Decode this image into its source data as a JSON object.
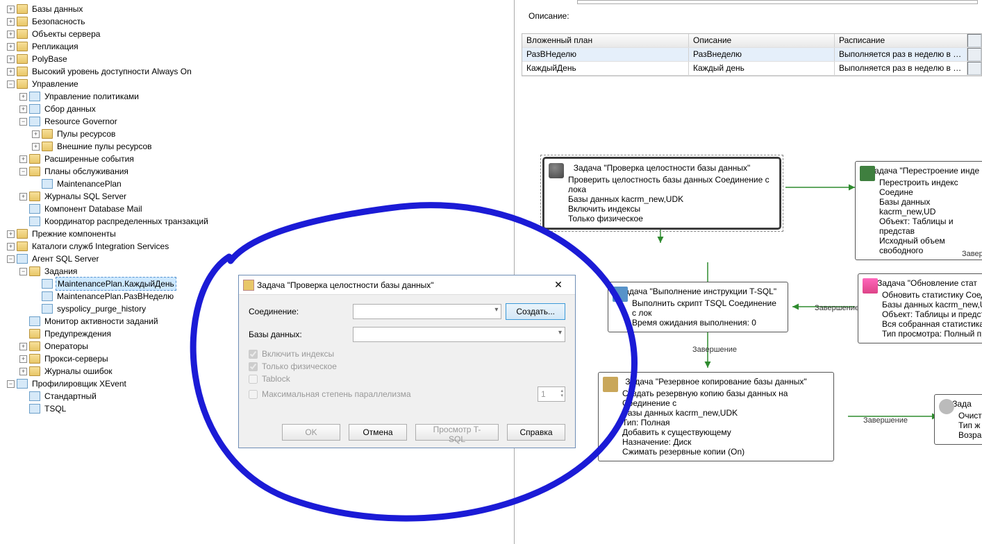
{
  "tree": {
    "items": [
      {
        "ind": 0,
        "exp": "+",
        "icon": "folder",
        "label": "Базы данных"
      },
      {
        "ind": 0,
        "exp": "+",
        "icon": "folder",
        "label": "Безопасность"
      },
      {
        "ind": 0,
        "exp": "+",
        "icon": "folder",
        "label": "Объекты сервера"
      },
      {
        "ind": 0,
        "exp": "+",
        "icon": "folder",
        "label": "Репликация"
      },
      {
        "ind": 0,
        "exp": "+",
        "icon": "folder",
        "label": "PolyBase"
      },
      {
        "ind": 0,
        "exp": "+",
        "icon": "folder",
        "label": "Высокий уровень доступности Always On"
      },
      {
        "ind": 0,
        "exp": "−",
        "icon": "folder",
        "label": "Управление"
      },
      {
        "ind": 1,
        "exp": "+",
        "icon": "generic",
        "label": "Управление политиками"
      },
      {
        "ind": 1,
        "exp": "+",
        "icon": "generic",
        "label": "Сбор данных"
      },
      {
        "ind": 1,
        "exp": "−",
        "icon": "generic",
        "label": "Resource Governor"
      },
      {
        "ind": 2,
        "exp": "+",
        "icon": "folder",
        "label": "Пулы ресурсов"
      },
      {
        "ind": 2,
        "exp": "+",
        "icon": "folder",
        "label": "Внешние пулы ресурсов"
      },
      {
        "ind": 1,
        "exp": "+",
        "icon": "folder",
        "label": "Расширенные события"
      },
      {
        "ind": 1,
        "exp": "−",
        "icon": "folder",
        "label": "Планы обслуживания"
      },
      {
        "ind": 2,
        "exp": " ",
        "icon": "generic",
        "label": "MaintenancePlan"
      },
      {
        "ind": 1,
        "exp": "+",
        "icon": "folder",
        "label": "Журналы SQL Server"
      },
      {
        "ind": 1,
        "exp": " ",
        "icon": "generic",
        "label": "Компонент Database Mail"
      },
      {
        "ind": 1,
        "exp": " ",
        "icon": "generic",
        "label": "Координатор распределенных транзакций"
      },
      {
        "ind": 0,
        "exp": "+",
        "icon": "folder",
        "label": "Прежние компоненты"
      },
      {
        "ind": 0,
        "exp": "+",
        "icon": "folder",
        "label": "Каталоги служб Integration Services"
      },
      {
        "ind": 0,
        "exp": "−",
        "icon": "generic",
        "label": "Агент SQL Server"
      },
      {
        "ind": 1,
        "exp": "−",
        "icon": "folder",
        "label": "Задания"
      },
      {
        "ind": 2,
        "exp": " ",
        "icon": "generic",
        "label": "MaintenancePlan.КаждыйДень",
        "selected": true
      },
      {
        "ind": 2,
        "exp": " ",
        "icon": "generic",
        "label": "MaintenancePlan.РазВНеделю"
      },
      {
        "ind": 2,
        "exp": " ",
        "icon": "generic",
        "label": "syspolicy_purge_history"
      },
      {
        "ind": 1,
        "exp": " ",
        "icon": "generic",
        "label": "Монитор активности заданий"
      },
      {
        "ind": 1,
        "exp": " ",
        "icon": "folder",
        "label": "Предупреждения"
      },
      {
        "ind": 1,
        "exp": "+",
        "icon": "folder",
        "label": "Операторы"
      },
      {
        "ind": 1,
        "exp": "+",
        "icon": "folder",
        "label": "Прокси-серверы"
      },
      {
        "ind": 1,
        "exp": "+",
        "icon": "folder",
        "label": "Журналы ошибок"
      },
      {
        "ind": 0,
        "exp": "−",
        "icon": "generic",
        "label": "Профилировщик XEvent"
      },
      {
        "ind": 1,
        "exp": " ",
        "icon": "generic",
        "label": "Стандартный"
      },
      {
        "ind": 1,
        "exp": " ",
        "icon": "generic",
        "label": "TSQL"
      }
    ]
  },
  "right": {
    "desc_label": "Описание:",
    "grid_headers": [
      "Вложенный план",
      "Описание",
      "Расписание"
    ],
    "rows": [
      {
        "c1": "РазВНеделю",
        "c2": "РазВнеделю",
        "c3": "Выполняется раз в неделю в …",
        "selected": true
      },
      {
        "c1": "КаждыйДень",
        "c2": "Каждый день",
        "c3": "Выполняется раз в неделю в …"
      }
    ]
  },
  "tasks": {
    "check": {
      "title": "Задача \"Проверка целостности базы данных\"",
      "lines": [
        "Проверить целостность базы данных Соединение с лока",
        "Базы данных kacrm_new,UDK",
        "Включить индексы",
        "Только физическое"
      ]
    },
    "rebuild": {
      "title": "Задача \"Перестроение инде",
      "lines": [
        "Перестроить индекс Соедине",
        "Базы данных kacrm_new,UD",
        "Объект: Таблицы и представ",
        "Исходный объем свободного"
      ]
    },
    "tsql": {
      "title": "Задача \"Выполнение инструкции T-SQL\"",
      "lines": [
        "Выполнить скрипт TSQL Соединение с лок",
        "Время ожидания выполнения: 0"
      ]
    },
    "stats": {
      "title": "Задача \"Обновление стат",
      "lines": [
        "Обновить статистику Соед",
        "Базы данных kacrm_new,U",
        "Объект: Таблицы и предст",
        "Вся собранная статистика",
        "Тип просмотра: Полный пр"
      ]
    },
    "backup": {
      "title": "Задача \"Резервное копирование базы данных\"",
      "lines": [
        "Создать резервную копию базы данных на Соединение с",
        "Базы данных kacrm_new,UDK",
        "Тип: Полная",
        "Добавить к существующему",
        "Назначение: Диск",
        "Сжимать резервные копии (On)"
      ]
    },
    "clean": {
      "title": "Зада",
      "lines": [
        "Очист",
        "Тип ж",
        "Возра"
      ]
    },
    "labels": {
      "done": "Завершение",
      "fail": "Заверш"
    }
  },
  "dialog": {
    "title": "Задача \"Проверка целостности базы данных\"",
    "connection_label": "Соединение:",
    "db_label": "Базы данных:",
    "create_btn": "Создать...",
    "chk_indexes": "Включить индексы",
    "chk_physical": "Только физическое",
    "chk_tablock": "Tablock",
    "chk_maxdop": "Максимальная степень параллелизма",
    "maxdop_value": "1",
    "btn_ok": "OK",
    "btn_cancel": "Отмена",
    "btn_tsql": "Просмотр T-SQL",
    "btn_help": "Справка"
  }
}
